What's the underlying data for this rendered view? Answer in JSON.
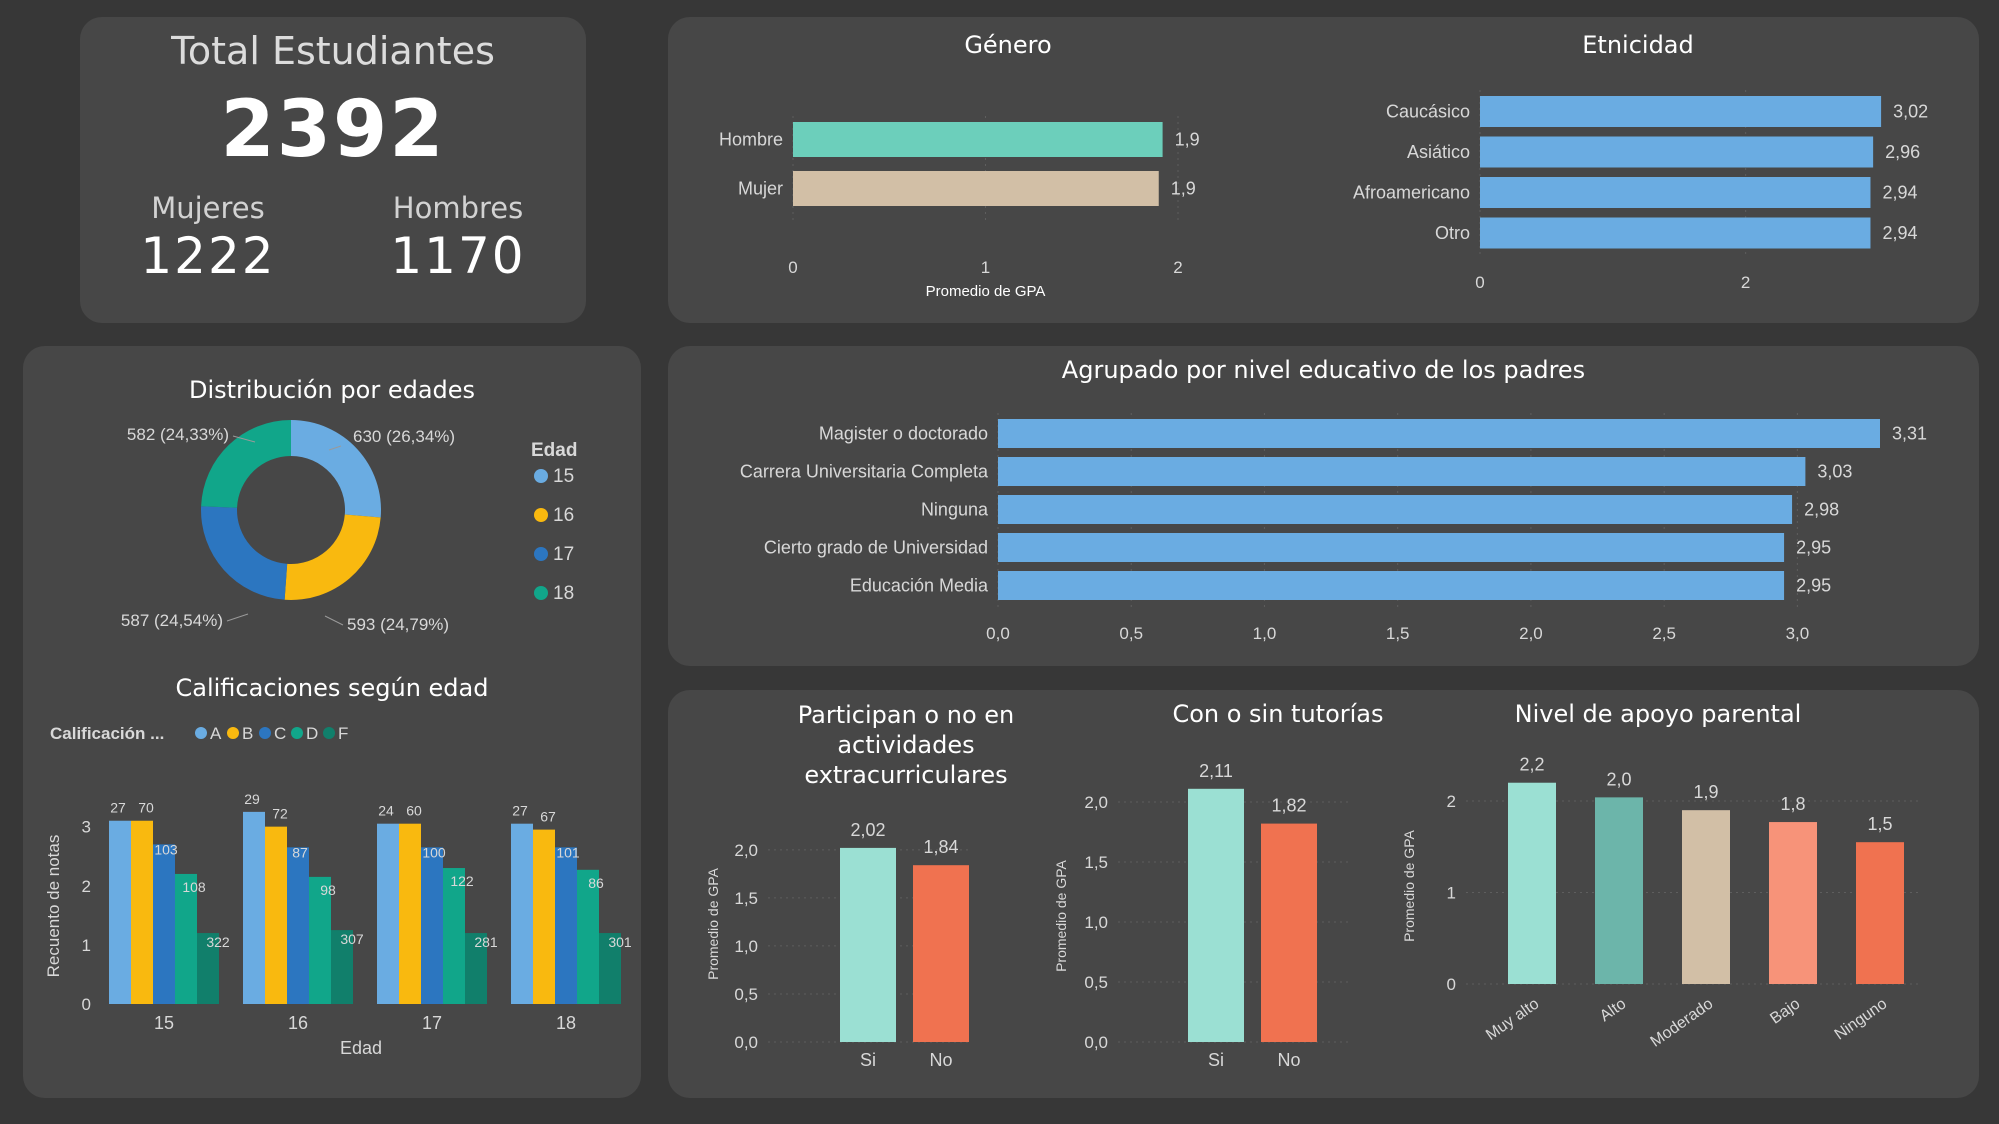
{
  "kpi": {
    "title": "Total Estudiantes",
    "total": "2392",
    "female_label": "Mujeres",
    "female_value": "1222",
    "male_label": "Hombres",
    "male_value": "1170"
  },
  "colors": {
    "background": "#373737",
    "panel": "#474747",
    "blue": "#6aace2",
    "teal": "#6ccfbb",
    "beige": "#d2bfa6",
    "age15": "#6aace2",
    "age16": "#f9b90f",
    "age17": "#2c76c0",
    "age18": "#11a68a",
    "gradeF": "#117f6b",
    "mint": "#9be0d3",
    "coral": "#f07250",
    "darkteal": "#6cb5aa",
    "salmon": "#f79379"
  },
  "chart_data": [
    {
      "id": "genero",
      "type": "bar",
      "orientation": "horizontal",
      "title": "Género",
      "categories": [
        "Hombre",
        "Mujer"
      ],
      "values": [
        1.92,
        1.9
      ],
      "value_labels": [
        "1,9",
        "1,9"
      ],
      "bar_colors": [
        "#6ccfbb",
        "#d2bfa6"
      ],
      "xlabel": "Promedio de GPA",
      "xlim": [
        0,
        2
      ],
      "xticks": [
        "0",
        "1",
        "2"
      ],
      "grid": true
    },
    {
      "id": "etnicidad",
      "type": "bar",
      "orientation": "horizontal",
      "title": "Etnicidad",
      "categories": [
        "Caucásico",
        "Asiático",
        "Afroamericano",
        "Otro"
      ],
      "values": [
        3.02,
        2.96,
        2.94,
        2.94
      ],
      "value_labels": [
        "3,02",
        "2,96",
        "2,94",
        "2,94"
      ],
      "xlim": [
        0,
        3.2
      ],
      "xticks": [
        "0",
        "2"
      ],
      "grid": true
    },
    {
      "id": "edades",
      "type": "pie",
      "donut": true,
      "title": "Distribución por edades",
      "legend_title": "Edad",
      "legend_position": "right",
      "labels": [
        "15",
        "16",
        "17",
        "18"
      ],
      "values": [
        630,
        593,
        587,
        582
      ],
      "slice_labels": [
        "630 (26,34%)",
        "593 (24,79%)",
        "587 (24,54%)",
        "582 (24,33%)"
      ]
    },
    {
      "id": "padres",
      "type": "bar",
      "orientation": "horizontal",
      "title": "Agrupado por nivel educativo de los padres",
      "categories": [
        "Magister o doctorado",
        "Carrera Universitaria Completa",
        "Ninguna",
        "Cierto grado de Universidad",
        "Educación Media"
      ],
      "values": [
        3.31,
        3.03,
        2.98,
        2.95,
        2.95
      ],
      "value_labels": [
        "3,31",
        "3,03",
        "2,98",
        "2,95",
        "2,95"
      ],
      "xlim": [
        0,
        3.31
      ],
      "xticks": [
        "0,0",
        "0,5",
        "1,0",
        "1,5",
        "2,0",
        "2,5",
        "3,0"
      ],
      "grid": true
    },
    {
      "id": "calificaciones",
      "type": "bar",
      "title": "Calificaciones según edad",
      "legend_title": "Calificación ...",
      "legend_position": "top-left",
      "categories": [
        "15",
        "16",
        "17",
        "18"
      ],
      "xlabel": "Edad",
      "ylabel": "Recuento de notas",
      "ylim": [
        0,
        3.4
      ],
      "yticks": [
        "0",
        "1",
        "2",
        "3"
      ],
      "series": [
        {
          "name": "A",
          "values": [
            3.1,
            3.25,
            3.05,
            3.05
          ],
          "labels": [
            "27",
            "29",
            "24",
            "27"
          ]
        },
        {
          "name": "B",
          "values": [
            3.1,
            3.0,
            3.05,
            2.95
          ],
          "labels": [
            "70",
            "72",
            "60",
            "67"
          ]
        },
        {
          "name": "C",
          "values": [
            2.7,
            2.65,
            2.65,
            2.65
          ],
          "labels": [
            "103",
            "87",
            "100",
            "101"
          ]
        },
        {
          "name": "D",
          "values": [
            2.2,
            2.15,
            2.3,
            2.27
          ],
          "labels": [
            "108",
            "98",
            "122",
            "86"
          ]
        },
        {
          "name": "F",
          "values": [
            1.2,
            1.25,
            1.2,
            1.2
          ],
          "labels": [
            "322",
            "307",
            "281",
            "301"
          ]
        }
      ]
    },
    {
      "id": "extracurriculares",
      "type": "bar",
      "title": "Participan o no en actividades extracurriculares",
      "categories": [
        "Si",
        "No"
      ],
      "values": [
        2.02,
        1.84
      ],
      "value_labels": [
        "2,02",
        "1,84"
      ],
      "bar_colors": [
        "#9be0d3",
        "#f07250"
      ],
      "ylabel": "Promedio de GPA",
      "ylim": [
        0,
        2.3
      ],
      "yticks": [
        "0,0",
        "0,5",
        "1,0",
        "1,5",
        "2,0"
      ],
      "grid": true
    },
    {
      "id": "tutorias",
      "type": "bar",
      "title": "Con o sin tutorías",
      "categories": [
        "Si",
        "No"
      ],
      "values": [
        2.11,
        1.82
      ],
      "value_labels": [
        "2,11",
        "1,82"
      ],
      "bar_colors": [
        "#9be0d3",
        "#f07250"
      ],
      "ylabel": "Promedio de GPA",
      "ylim": [
        0,
        2.2
      ],
      "yticks": [
        "0,0",
        "0,5",
        "1,0",
        "1,5",
        "2,0"
      ],
      "grid": true
    },
    {
      "id": "apoyo",
      "type": "bar",
      "title": "Nivel de apoyo parental",
      "categories": [
        "Muy alto",
        "Alto",
        "Moderado",
        "Bajo",
        "Ninguno"
      ],
      "values": [
        2.2,
        2.04,
        1.9,
        1.77,
        1.55
      ],
      "value_labels": [
        "2,2",
        "2,0",
        "1,9",
        "1,8",
        "1,5"
      ],
      "bar_colors": [
        "#9be0d3",
        "#6cb5aa",
        "#d2bfa6",
        "#f79379",
        "#f07250"
      ],
      "ylabel": "Promedio de GPA",
      "ylim": [
        0,
        2.35
      ],
      "yticks": [
        "0",
        "1",
        "2"
      ],
      "grid": true
    }
  ]
}
